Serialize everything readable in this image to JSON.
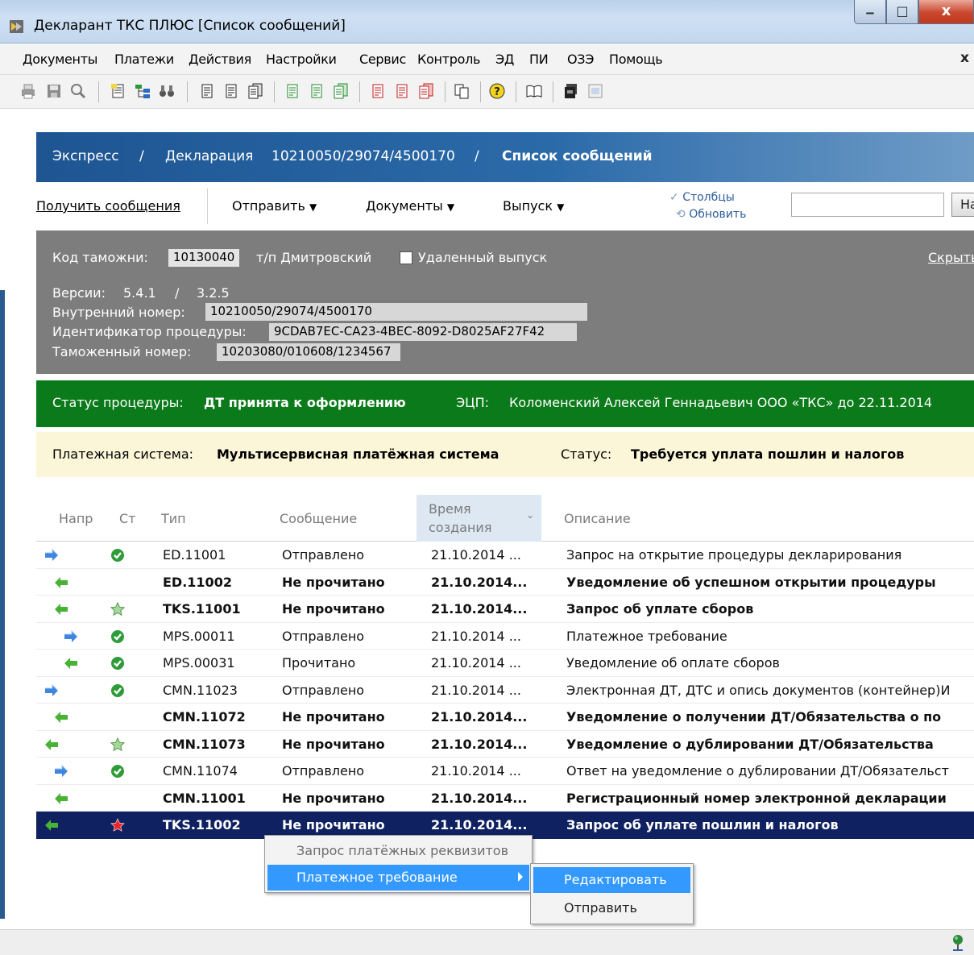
{
  "window": {
    "title": "Декларант ТКС ПЛЮС [Список сообщений]",
    "minimize": "‒",
    "maximize": "□",
    "close": "x"
  },
  "menu": {
    "items": [
      "Документы",
      "Платежи",
      "Действия",
      "Настройки",
      "Сервис",
      "Контроль",
      "ЭД",
      "ПИ",
      "ОЗЭ",
      "Помощь"
    ],
    "close_label": "x"
  },
  "breadcrumb": {
    "express": "Экспресс",
    "sep": "/",
    "declaration": "Декларация",
    "decl_number": "10210050/29074/4500170",
    "current": "Список сообщений"
  },
  "actions": {
    "get_messages": "Получить сообщения",
    "send": "Отправить",
    "documents": "Документы",
    "release": "Выпуск",
    "columns": "Столбцы",
    "refresh": "Обновить",
    "search_value": "",
    "find_label": "Найти",
    "dropdown_arrow": "▼",
    "check_mark": "✓",
    "refresh_mark": "⟲"
  },
  "info": {
    "customs_code_label": "Код таможни:",
    "customs_code": "10130040",
    "post_name": "т/п Дмитровский",
    "remote_release_label": "Удаленный выпуск",
    "remote_release_checked": false,
    "hide_label": "Скрыть",
    "versions_label": "Версии:",
    "version_1": "5.4.1",
    "version_sep": "/",
    "version_2": "3.2.5",
    "internal_number_label": "Внутренний номер:",
    "internal_number": "10210050/29074/4500170",
    "procedure_id_label": "Идентификатор процедуры:",
    "procedure_id": "9CDAB7EC-CA23-4BEC-8092-D8025AF27F42",
    "customs_number_label": "Таможенный номер:",
    "customs_number": "10203080/010608/1234567"
  },
  "status": {
    "procedure_label": "Статус процедуры:",
    "procedure_value": "ДТ принята к оформлению",
    "ecp_label": "ЭЦП:",
    "ecp_value": "Коломенский Алексей Геннадьевич   ООО «ТКС»   до 22.11.2014",
    "color": "#0b7a1a"
  },
  "payment": {
    "system_label": "Платежная система:",
    "system_value": "Мультисервисная платёжная система",
    "status_label": "Статус:",
    "status_value": "Требуется уплата пошлин и налогов"
  },
  "table": {
    "headers": {
      "direction": "Напр",
      "state": "Ст",
      "type": "Тип",
      "message": "Сообщение",
      "time_1": "Время",
      "time_2": "создания",
      "description": "Описание",
      "sort_arrow": "⌄"
    },
    "rows": [
      {
        "dir": "out",
        "indent": 0,
        "state": "check",
        "type": "ED.11001",
        "msg": "Отправлено",
        "time": "21.10.2014 ...",
        "desc": "Запрос на открытие процедуры декларирования",
        "unread": false
      },
      {
        "dir": "in",
        "indent": 1,
        "state": "",
        "type": "ED.11002",
        "msg": "Не прочитано",
        "time": "21.10.2014...",
        "desc": "Уведомление об успешном открытии процедуры",
        "unread": true
      },
      {
        "dir": "in",
        "indent": 1,
        "state": "star-green",
        "type": "TKS.11001",
        "msg": "Не прочитано",
        "time": "21.10.2014...",
        "desc": "Запрос об уплате сборов",
        "unread": true
      },
      {
        "dir": "out",
        "indent": 2,
        "state": "check",
        "type": "MPS.00011",
        "msg": "Отправлено",
        "time": "21.10.2014 ...",
        "desc": "Платежное требование",
        "unread": false
      },
      {
        "dir": "in",
        "indent": 2,
        "state": "check",
        "type": "MPS.00031",
        "msg": "Прочитано",
        "time": "21.10.2014 ...",
        "desc": "Уведомление об оплате сборов",
        "unread": false
      },
      {
        "dir": "out",
        "indent": 0,
        "state": "check",
        "type": "CMN.11023",
        "msg": "Отправлено",
        "time": "21.10.2014 ...",
        "desc": "Электронная ДТ, ДТС и опись документов (контейнер)И",
        "unread": false
      },
      {
        "dir": "in",
        "indent": 1,
        "state": "",
        "type": "CMN.11072",
        "msg": "Не прочитано",
        "time": "21.10.2014...",
        "desc": "Уведомление о получении ДТ/Обязательства о по",
        "unread": true
      },
      {
        "dir": "in",
        "indent": 0,
        "state": "star-green",
        "type": "CMN.11073",
        "msg": "Не прочитано",
        "time": "21.10.2014...",
        "desc": "Уведомление о дублировании ДТ/Обязательства",
        "unread": true
      },
      {
        "dir": "out",
        "indent": 1,
        "state": "check",
        "type": "CMN.11074",
        "msg": "Отправлено",
        "time": "21.10.2014 ...",
        "desc": "Ответ на уведомление о дублировании ДТ/Обязательст",
        "unread": false
      },
      {
        "dir": "in",
        "indent": 1,
        "state": "",
        "type": "CMN.11001",
        "msg": "Не прочитано",
        "time": "21.10.2014...",
        "desc": "Регистрационный номер электронной декларации",
        "unread": true
      },
      {
        "dir": "in",
        "indent": 0,
        "state": "star-red",
        "type": "TKS.11002",
        "msg": "Не прочитано",
        "time": "21.10.2014...",
        "desc": "Запрос об уплате пошлин и налогов",
        "unread": true,
        "selected": true
      }
    ]
  },
  "context_menu": {
    "item_1": "Запрос платёжных реквизитов",
    "item_2": "Платежное требование",
    "submenu_1": "Редактировать",
    "submenu_2": "Отправить"
  },
  "colors": {
    "selected_row": "#0f2160",
    "menu_highlight": "#3399ff",
    "header_blue": "#1e5592"
  }
}
